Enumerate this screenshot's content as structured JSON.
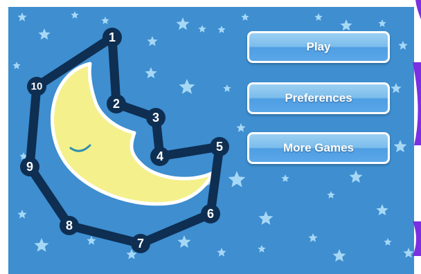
{
  "menu": {
    "play_label": "Play",
    "preferences_label": "Preferences",
    "more_games_label": "More Games"
  },
  "puzzle": {
    "dots": [
      {
        "label": "1"
      },
      {
        "label": "2"
      },
      {
        "label": "3"
      },
      {
        "label": "4"
      },
      {
        "label": "5"
      },
      {
        "label": "6"
      },
      {
        "label": "7"
      },
      {
        "label": "8"
      },
      {
        "label": "9"
      },
      {
        "label": "10"
      }
    ]
  },
  "colors": {
    "background": "#3e8ed0",
    "star": "#a6d8f6",
    "moon_fill": "#f4f08c",
    "moon_outline": "#ffffff",
    "path": "#0e2e52",
    "button_top": "#9ccff2",
    "button_bottom": "#4f9ee3",
    "edge_accent": "#7b2fe0"
  },
  "icons": [
    "star-icon",
    "moon-icon"
  ]
}
